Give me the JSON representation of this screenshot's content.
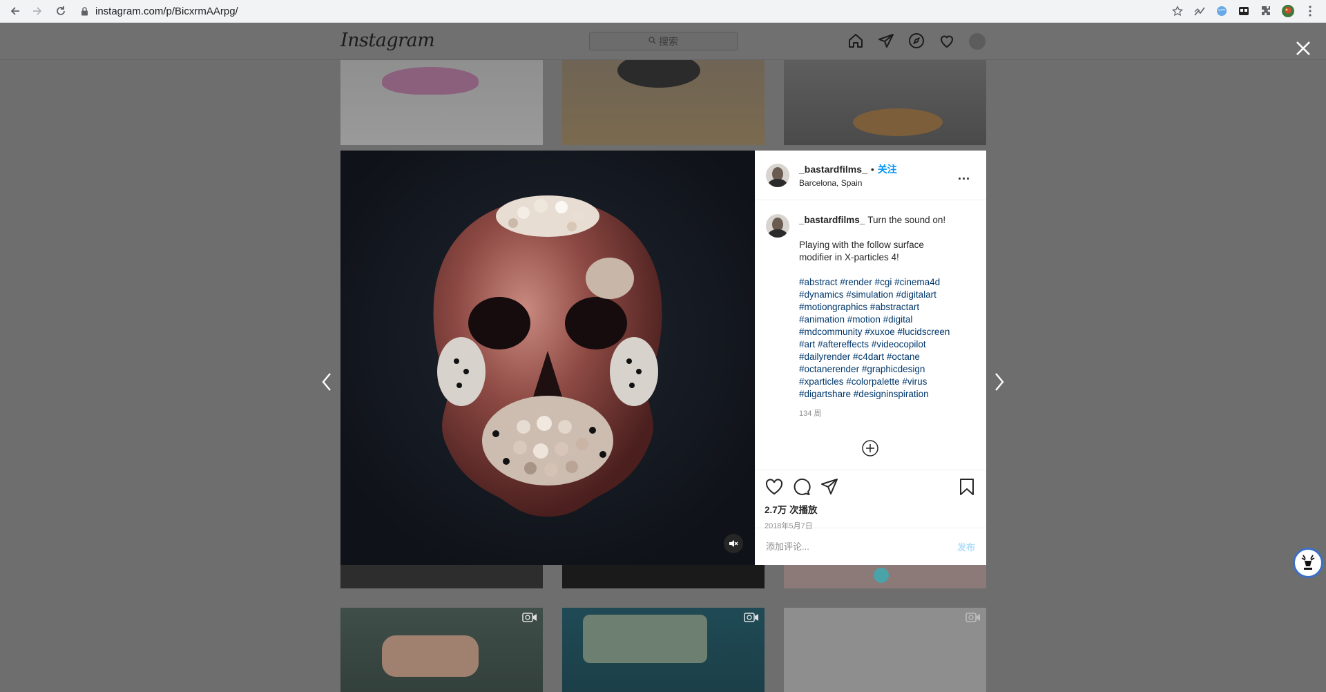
{
  "browser": {
    "url": "instagram.com/p/BicxrmAArpg/"
  },
  "ig_header": {
    "logo": "Instagram",
    "search_placeholder": "搜索"
  },
  "post": {
    "username": "_bastardfilms_",
    "separator": "•",
    "follow_label": "关注",
    "location": "Barcelona, Spain",
    "more_label": "...",
    "caption_first": "Turn the sound on!",
    "caption_lines": [
      "Playing with the follow surface",
      "modifier in X-particles 4!"
    ],
    "hashtag_lines": [
      "#abstract #render #cgi #cinema4d",
      "#dynamics #simulation #digitalart",
      "#motiongraphics #abstractart",
      "#animation #motion #digital",
      "#mdcommunity #xuxoe #lucidscreen",
      "#art #aftereffects #videocopilot",
      "#dailyrender #c4dart #octane",
      "#octanerender #graphicdesign",
      "#xparticles #colorpalette #virus",
      "#digartshare #designinspiration"
    ],
    "age": "134 周",
    "views": "2.7万 次播放",
    "date": "2018年5月7日",
    "comment_placeholder": "添加评论...",
    "post_button": "发布"
  },
  "colors": {
    "accent": "#0095f6",
    "post_disabled": "#b2dffc",
    "hashtag": "#00376b",
    "muted": "#8e8e8e"
  }
}
